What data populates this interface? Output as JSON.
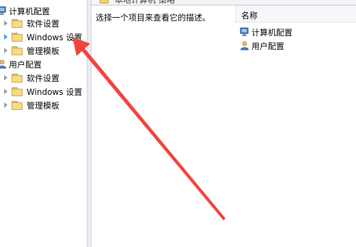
{
  "tree": {
    "computer_config": {
      "label": "计算机配置",
      "children": [
        {
          "label": "软件设置",
          "icon": "folder-icon"
        },
        {
          "label": "Windows 设置",
          "icon": "folder-icon"
        },
        {
          "label": "管理模板",
          "icon": "folder-icon"
        }
      ]
    },
    "user_config": {
      "label": "用户配置",
      "children": [
        {
          "label": "软件设置",
          "icon": "folder-icon"
        },
        {
          "label": "Windows 设置",
          "icon": "folder-icon"
        },
        {
          "label": "管理模板",
          "icon": "folder-icon"
        }
      ]
    }
  },
  "details": {
    "header_title": "本地计算机 策略",
    "description": "选择一个项目来查看它的描述。",
    "column_header": "名称",
    "items": [
      {
        "label": "计算机配置",
        "icon": "computer-icon"
      },
      {
        "label": "用户配置",
        "icon": "user-icon"
      }
    ]
  },
  "annotation": {
    "color": "#f2433d",
    "shape": "arrow"
  },
  "colors": {
    "selected_expander": "#2ba3ea",
    "folder": "#f6da86"
  }
}
